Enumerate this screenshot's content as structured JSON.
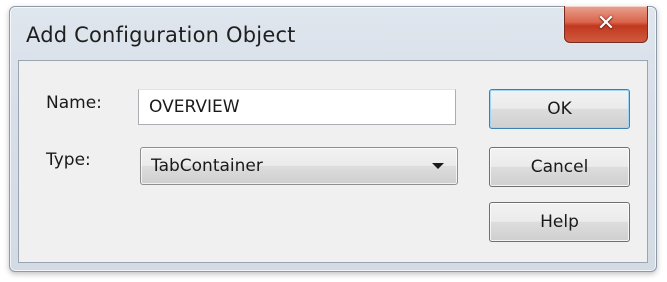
{
  "window": {
    "title": "Add Configuration Object",
    "close_icon": "close-x-icon",
    "close_glyph": "✕"
  },
  "form": {
    "name_label": "Name:",
    "name_value": "OVERVIEW",
    "type_label": "Type:",
    "type_value": "TabContainer",
    "type_dropdown_icon": "chevron-down-icon"
  },
  "buttons": {
    "ok_label": "OK",
    "cancel_label": "Cancel",
    "help_label": "Help"
  },
  "colors": {
    "close_button": "#c1391f",
    "titlebar": "#dfe6ee",
    "client_background": "#f0f0f0"
  }
}
